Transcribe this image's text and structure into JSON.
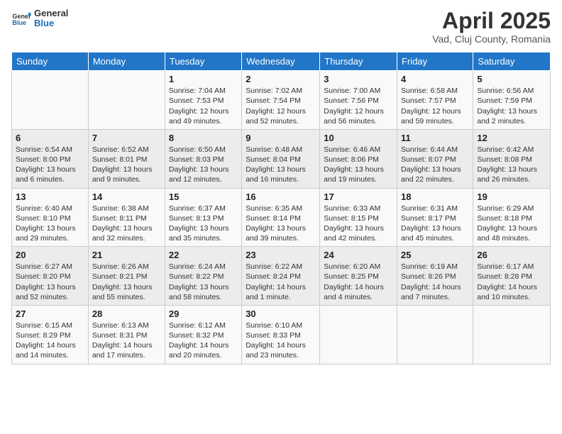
{
  "header": {
    "logo_general": "General",
    "logo_blue": "Blue",
    "main_title": "April 2025",
    "subtitle": "Vad, Cluj County, Romania"
  },
  "calendar": {
    "days_of_week": [
      "Sunday",
      "Monday",
      "Tuesday",
      "Wednesday",
      "Thursday",
      "Friday",
      "Saturday"
    ],
    "weeks": [
      [
        {
          "day": "",
          "detail": ""
        },
        {
          "day": "",
          "detail": ""
        },
        {
          "day": "1",
          "detail": "Sunrise: 7:04 AM\nSunset: 7:53 PM\nDaylight: 12 hours and 49 minutes."
        },
        {
          "day": "2",
          "detail": "Sunrise: 7:02 AM\nSunset: 7:54 PM\nDaylight: 12 hours and 52 minutes."
        },
        {
          "day": "3",
          "detail": "Sunrise: 7:00 AM\nSunset: 7:56 PM\nDaylight: 12 hours and 56 minutes."
        },
        {
          "day": "4",
          "detail": "Sunrise: 6:58 AM\nSunset: 7:57 PM\nDaylight: 12 hours and 59 minutes."
        },
        {
          "day": "5",
          "detail": "Sunrise: 6:56 AM\nSunset: 7:59 PM\nDaylight: 13 hours and 2 minutes."
        }
      ],
      [
        {
          "day": "6",
          "detail": "Sunrise: 6:54 AM\nSunset: 8:00 PM\nDaylight: 13 hours and 6 minutes."
        },
        {
          "day": "7",
          "detail": "Sunrise: 6:52 AM\nSunset: 8:01 PM\nDaylight: 13 hours and 9 minutes."
        },
        {
          "day": "8",
          "detail": "Sunrise: 6:50 AM\nSunset: 8:03 PM\nDaylight: 13 hours and 12 minutes."
        },
        {
          "day": "9",
          "detail": "Sunrise: 6:48 AM\nSunset: 8:04 PM\nDaylight: 13 hours and 16 minutes."
        },
        {
          "day": "10",
          "detail": "Sunrise: 6:46 AM\nSunset: 8:06 PM\nDaylight: 13 hours and 19 minutes."
        },
        {
          "day": "11",
          "detail": "Sunrise: 6:44 AM\nSunset: 8:07 PM\nDaylight: 13 hours and 22 minutes."
        },
        {
          "day": "12",
          "detail": "Sunrise: 6:42 AM\nSunset: 8:08 PM\nDaylight: 13 hours and 26 minutes."
        }
      ],
      [
        {
          "day": "13",
          "detail": "Sunrise: 6:40 AM\nSunset: 8:10 PM\nDaylight: 13 hours and 29 minutes."
        },
        {
          "day": "14",
          "detail": "Sunrise: 6:38 AM\nSunset: 8:11 PM\nDaylight: 13 hours and 32 minutes."
        },
        {
          "day": "15",
          "detail": "Sunrise: 6:37 AM\nSunset: 8:13 PM\nDaylight: 13 hours and 35 minutes."
        },
        {
          "day": "16",
          "detail": "Sunrise: 6:35 AM\nSunset: 8:14 PM\nDaylight: 13 hours and 39 minutes."
        },
        {
          "day": "17",
          "detail": "Sunrise: 6:33 AM\nSunset: 8:15 PM\nDaylight: 13 hours and 42 minutes."
        },
        {
          "day": "18",
          "detail": "Sunrise: 6:31 AM\nSunset: 8:17 PM\nDaylight: 13 hours and 45 minutes."
        },
        {
          "day": "19",
          "detail": "Sunrise: 6:29 AM\nSunset: 8:18 PM\nDaylight: 13 hours and 48 minutes."
        }
      ],
      [
        {
          "day": "20",
          "detail": "Sunrise: 6:27 AM\nSunset: 8:20 PM\nDaylight: 13 hours and 52 minutes."
        },
        {
          "day": "21",
          "detail": "Sunrise: 6:26 AM\nSunset: 8:21 PM\nDaylight: 13 hours and 55 minutes."
        },
        {
          "day": "22",
          "detail": "Sunrise: 6:24 AM\nSunset: 8:22 PM\nDaylight: 13 hours and 58 minutes."
        },
        {
          "day": "23",
          "detail": "Sunrise: 6:22 AM\nSunset: 8:24 PM\nDaylight: 14 hours and 1 minute."
        },
        {
          "day": "24",
          "detail": "Sunrise: 6:20 AM\nSunset: 8:25 PM\nDaylight: 14 hours and 4 minutes."
        },
        {
          "day": "25",
          "detail": "Sunrise: 6:19 AM\nSunset: 8:26 PM\nDaylight: 14 hours and 7 minutes."
        },
        {
          "day": "26",
          "detail": "Sunrise: 6:17 AM\nSunset: 8:28 PM\nDaylight: 14 hours and 10 minutes."
        }
      ],
      [
        {
          "day": "27",
          "detail": "Sunrise: 6:15 AM\nSunset: 8:29 PM\nDaylight: 14 hours and 14 minutes."
        },
        {
          "day": "28",
          "detail": "Sunrise: 6:13 AM\nSunset: 8:31 PM\nDaylight: 14 hours and 17 minutes."
        },
        {
          "day": "29",
          "detail": "Sunrise: 6:12 AM\nSunset: 8:32 PM\nDaylight: 14 hours and 20 minutes."
        },
        {
          "day": "30",
          "detail": "Sunrise: 6:10 AM\nSunset: 8:33 PM\nDaylight: 14 hours and 23 minutes."
        },
        {
          "day": "",
          "detail": ""
        },
        {
          "day": "",
          "detail": ""
        },
        {
          "day": "",
          "detail": ""
        }
      ]
    ]
  }
}
